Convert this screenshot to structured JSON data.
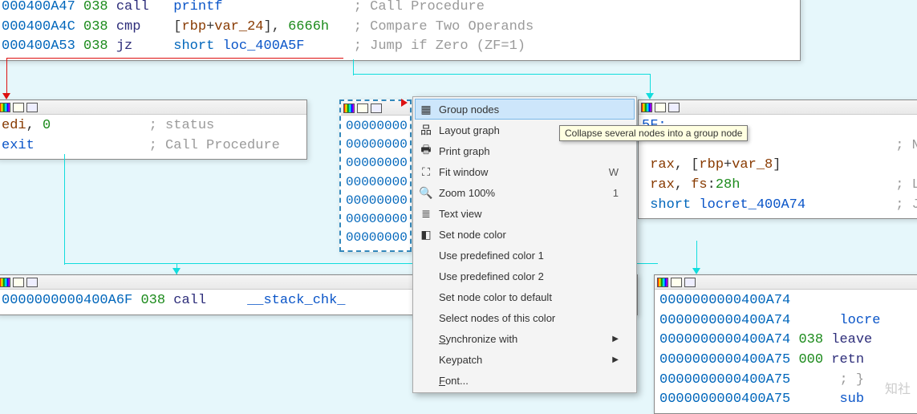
{
  "node_top": {
    "rows": [
      {
        "addr": "000400A47",
        "stk": "038",
        "mnem": "call",
        "ops_html": "<span class='op-name'>printf</span>",
        "comment": "; Call Procedure"
      },
      {
        "addr": "000400A4C",
        "stk": "038",
        "mnem": "cmp",
        "ops_html": "[<span class='op-reg'>rbp</span>+<span class='op-var'>var_24</span>], <span class='op-imm'>6666h</span>",
        "comment": "; Compare Two Operands"
      },
      {
        "addr": "000400A53",
        "stk": "038",
        "mnem": "jz",
        "ops_html": "<span class='kw'>short</span> <span class='op-name'>loc_400A5F</span>",
        "comment": "; Jump if Zero (ZF=1)"
      }
    ]
  },
  "node_left": {
    "rows": [
      {
        "ops_html": "<span class='op-reg'>edi</span>, <span class='op-imm'>0</span>",
        "comment": "; status"
      },
      {
        "ops_html": "<span class='op-name'>exit</span>",
        "comment": "; Call Procedure"
      }
    ]
  },
  "node_midaddr": {
    "lines": [
      "00000000",
      "00000000",
      "00000000",
      "00000000",
      "00000000",
      "00000000",
      "00000000"
    ]
  },
  "node_right": {
    "rows": [
      {
        "addr_suffix": "5F:",
        "ops_html": "",
        "comment": ""
      },
      {
        "ops_html": "",
        "comment": "; No Operat"
      },
      {
        "ops_html": "<span class='op-reg'>rax</span>, [<span class='op-reg'>rbp</span>+<span class='op-var'>var_8</span>]",
        "comment": ""
      },
      {
        "ops_html": "<span class='op-reg'>rax</span>, <span class='op-reg'>fs</span>:<span class='op-imm'>28h</span>",
        "comment": "; Logical E"
      },
      {
        "ops_html": "<span class='kw'>short</span> <span class='op-name'>locret_400A74</span>",
        "comment": "; Jump"
      }
    ]
  },
  "node_bl": {
    "row": {
      "addr": "0000000000400A6F",
      "stk": "038",
      "mnem": "call",
      "ops_html": "<span class='op-name'>__stack_chk_</span>"
    }
  },
  "node_br": {
    "rows": [
      {
        "addr": "0000000000400A74",
        "stk": "",
        "mnem": "",
        "tail": ""
      },
      {
        "addr": "0000000000400A74",
        "stk": "",
        "mnem": "",
        "tail": "locre"
      },
      {
        "addr": "0000000000400A74",
        "stk": "038",
        "mnem": "leave",
        "tail": ""
      },
      {
        "addr": "0000000000400A75",
        "stk": "000",
        "mnem": "retn",
        "tail": ""
      },
      {
        "addr": "0000000000400A75",
        "stk": "",
        "mnem": "",
        "tail": "; }"
      },
      {
        "addr": "0000000000400A75",
        "stk": "",
        "mnem": "",
        "tail": "sub"
      }
    ]
  },
  "ctx": {
    "items": [
      {
        "label": "Group nodes",
        "icon": "▦",
        "hot": true
      },
      {
        "label": "Layout graph",
        "icon": "品"
      },
      {
        "label": "Print graph",
        "icon": "🖶"
      },
      {
        "label": "Fit window",
        "icon": "⛶",
        "short": "W"
      },
      {
        "label": "Zoom 100%",
        "icon": "🔍",
        "short": "1"
      },
      {
        "label": "Text view",
        "icon": "≣"
      },
      {
        "label": "Set node color",
        "icon": "◧"
      },
      {
        "label": "Use predefined color 1"
      },
      {
        "label": "Use predefined color 2"
      },
      {
        "label": "Set node color to default"
      },
      {
        "label": "Select nodes of this color"
      },
      {
        "label": "Synchronize with",
        "submenu": true,
        "underline": 0
      },
      {
        "label": "Keypatch",
        "submenu": true
      },
      {
        "label": "Font...",
        "underline": 0
      }
    ]
  },
  "tooltip": "Collapse several nodes into a group node",
  "watermark": "知社"
}
